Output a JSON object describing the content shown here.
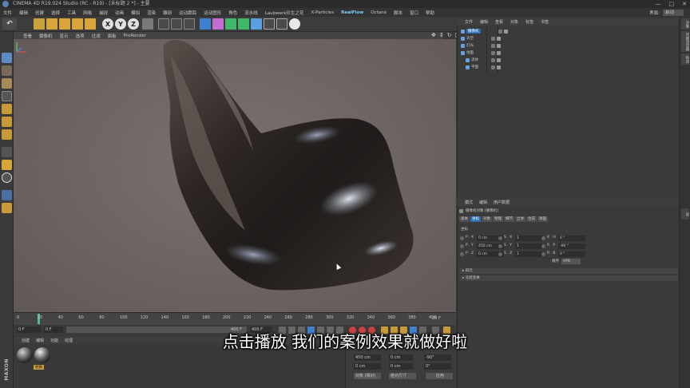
{
  "window": {
    "title": "CINEMA 4D R19.024 Studio (RC - R19) - [未标题 2 *] - 主要",
    "controls": [
      "—",
      "□",
      "✕"
    ]
  },
  "menubar": {
    "items": [
      "文件",
      "编辑",
      "创建",
      "选择",
      "工具",
      "网格",
      "捕捉",
      "动画",
      "模拟",
      "渲染",
      "雕刻",
      "运动跟踪",
      "运动图形",
      "角色",
      "流水线",
      "Laubwerk珍生之花",
      "X-Particles",
      "RealFlow",
      "Octane",
      "脚本",
      "窗口",
      "帮助"
    ],
    "highlighted": "RealFlow",
    "layout_label": "界面:",
    "layout_value": "启动"
  },
  "viewport": {
    "menu": [
      "查看",
      "摄像机",
      "显示",
      "选项",
      "过滤",
      "面板",
      "ProRender"
    ],
    "nav_icons": [
      "move-icon",
      "zoom-icon",
      "rotate-icon",
      "maximize-icon"
    ]
  },
  "timeline": {
    "ticks": [
      "0",
      "20",
      "40",
      "60",
      "80",
      "100",
      "120",
      "140",
      "160",
      "180",
      "200",
      "220",
      "240",
      "260",
      "280",
      "300",
      "320",
      "340",
      "360",
      "380",
      "400"
    ],
    "end_label": "20 F"
  },
  "transport": {
    "current_frame": "0 F",
    "range_start": "0 F",
    "range_end": "400 F",
    "range_max": "400 F"
  },
  "material": {
    "tabs": [
      "创建",
      "编辑",
      "功能",
      "纹理"
    ],
    "items": [
      {
        "name": ""
      },
      {
        "name": "材质"
      }
    ]
  },
  "coords_bottom": {
    "rows": [
      {
        "a": "450 cm",
        "b": "0 cm",
        "c": "-90°"
      },
      {
        "a": "0 cm",
        "b": "0 cm",
        "c": "0°"
      }
    ],
    "mode_a": "对象 (相对)",
    "mode_b": "绝对尺寸",
    "apply": "应用"
  },
  "object_manager": {
    "menu": [
      "文件",
      "编辑",
      "查看",
      "对象",
      "标签",
      "书签"
    ],
    "rows": [
      {
        "name": "摄像机",
        "selected": true,
        "indent": 0
      },
      {
        "name": "天空",
        "selected": false,
        "indent": 0
      },
      {
        "name": "灯光",
        "selected": false,
        "indent": 0
      },
      {
        "name": "地面",
        "selected": false,
        "indent": 0
      },
      {
        "name": "流体",
        "selected": false,
        "indent": 1
      },
      {
        "name": "平面",
        "selected": false,
        "indent": 1
      }
    ]
  },
  "attribute_manager": {
    "menu": [
      "模式",
      "编辑",
      "用户数据"
    ],
    "header": "摄像机对象 [摄像机]",
    "tabs": [
      "基本",
      "坐标",
      "对象",
      "物理",
      "细节",
      "立体",
      "合成",
      "球面"
    ],
    "active_tab": "坐标",
    "section": "坐标",
    "rows": [
      {
        "p_lbl": "P . X",
        "p": "0 cm",
        "s_lbl": "S . X",
        "s": "1",
        "r_lbl": "R . H",
        "r": "0 °"
      },
      {
        "p_lbl": "P . Y",
        "p": "450 cm",
        "s_lbl": "S . Y",
        "s": "1",
        "r_lbl": "R . P",
        "r": "-90 °"
      },
      {
        "p_lbl": "P . Z",
        "p": "0 cm",
        "s_lbl": "S . Z",
        "s": "1",
        "r_lbl": "R . B",
        "r": "0 °"
      }
    ],
    "order_label": "顺序",
    "order_value": "HPB",
    "collapsed": [
      "四元",
      "冻结变换"
    ]
  },
  "right_strip": {
    "tabs": [
      "对象",
      "内容浏览器",
      "构造",
      "层"
    ]
  },
  "subtitle": "点击播放  我们的案例效果就做好啦",
  "colors": {
    "accent_blue": "#2d6db3",
    "playhead_green": "#4fc08a",
    "realflow_cyan": "#7ed1ff",
    "viewport_bg": "#6d6362"
  }
}
